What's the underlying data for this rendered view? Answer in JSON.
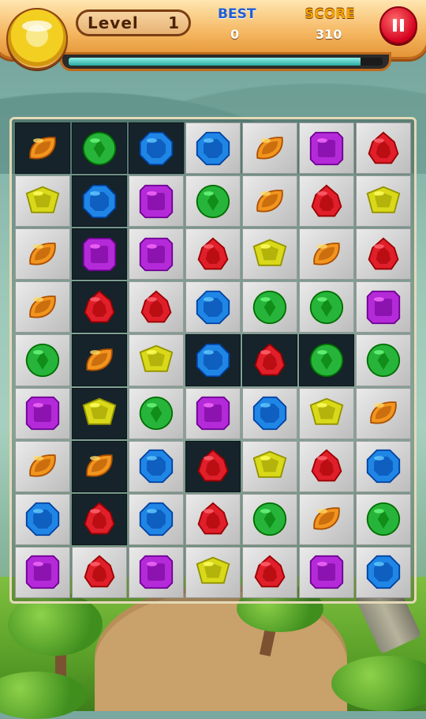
{
  "hud": {
    "level_label": "Level",
    "level_value": "1",
    "best_label": "BEST",
    "best_value": "0",
    "score_label": "SCORE",
    "score_value": "310",
    "progress_fraction": 0.93,
    "pause_icon": "pause-icon"
  },
  "colors": {
    "orange": "#f2951f",
    "green": "#27b43a",
    "blue": "#1f86e6",
    "purple": "#b42ad8",
    "red": "#e01f2b",
    "yellow": "#d9d91a"
  },
  "board": {
    "columns": 7,
    "rows": 9,
    "cells": [
      [
        "orange",
        "green",
        "blue",
        "blue",
        "orange",
        "purple",
        "red"
      ],
      [
        "yellow",
        "blue",
        "purple",
        "green",
        "orange",
        "red",
        "yellow"
      ],
      [
        "orange",
        "purple",
        "purple",
        "red",
        "yellow",
        "orange",
        "red"
      ],
      [
        "orange",
        "red",
        "red",
        "blue",
        "green",
        "green",
        "purple"
      ],
      [
        "green",
        "orange",
        "yellow",
        "blue",
        "red",
        "green",
        "green"
      ],
      [
        "purple",
        "yellow",
        "green",
        "purple",
        "blue",
        "yellow",
        "orange"
      ],
      [
        "orange",
        "orange",
        "blue",
        "red",
        "yellow",
        "red",
        "blue"
      ],
      [
        "blue",
        "red",
        "blue",
        "red",
        "green",
        "orange",
        "green"
      ],
      [
        "purple",
        "red",
        "purple",
        "yellow",
        "red",
        "purple",
        "blue"
      ]
    ],
    "dark_cells": [
      [
        0,
        0
      ],
      [
        0,
        1
      ],
      [
        0,
        2
      ],
      [
        1,
        1
      ],
      [
        2,
        1
      ],
      [
        3,
        1
      ],
      [
        4,
        1
      ],
      [
        4,
        3
      ],
      [
        4,
        4
      ],
      [
        4,
        5
      ],
      [
        5,
        1
      ],
      [
        6,
        1
      ],
      [
        6,
        3
      ],
      [
        7,
        1
      ]
    ]
  }
}
